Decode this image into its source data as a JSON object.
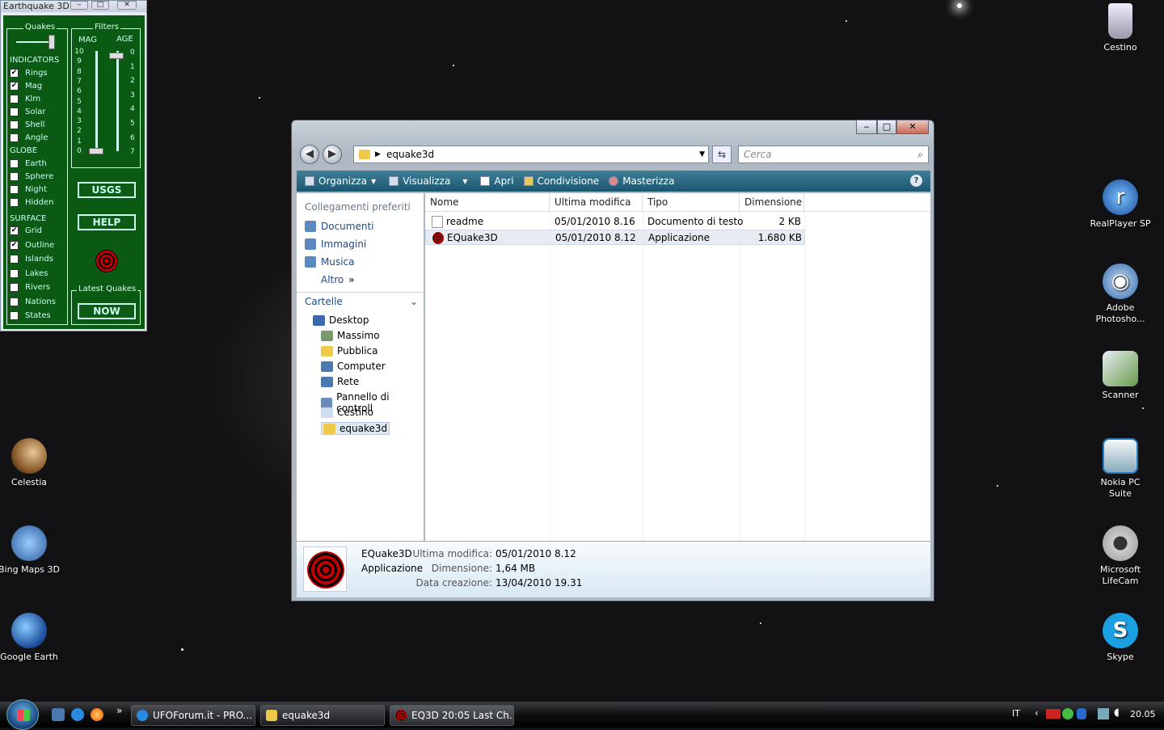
{
  "eq_window": {
    "title": "Earthquake 3D",
    "quakes_label": "Quakes",
    "filters_label": "Filters",
    "mag_label": "MAG",
    "age_label": "AGE",
    "mag_scale": [
      "10",
      "9",
      "8",
      "7",
      "6",
      "5",
      "4",
      "3",
      "2",
      "1",
      "0"
    ],
    "age_scale": [
      "0",
      "1",
      "2",
      "3",
      "4",
      "5",
      "6",
      "7"
    ],
    "indicators_label": "INDICATORS",
    "indicators": [
      {
        "label": "Rings",
        "checked": true
      },
      {
        "label": "Mag",
        "checked": true
      },
      {
        "label": "Klm",
        "checked": false
      },
      {
        "label": "Solar",
        "checked": false
      },
      {
        "label": "Shell",
        "checked": false
      },
      {
        "label": "Angle",
        "checked": false
      }
    ],
    "globe_label": "GLOBE",
    "globe": [
      {
        "label": "Earth",
        "checked": false
      },
      {
        "label": "Sphere",
        "checked": false
      },
      {
        "label": "Night",
        "checked": false
      },
      {
        "label": "Hidden",
        "checked": false
      }
    ],
    "surface_label": "SURFACE",
    "surface": [
      {
        "label": "Grid",
        "checked": true
      },
      {
        "label": "Outline",
        "checked": true
      },
      {
        "label": "Islands",
        "checked": false
      },
      {
        "label": "Lakes",
        "checked": false
      },
      {
        "label": "Rivers",
        "checked": false
      },
      {
        "label": "Nations",
        "checked": false
      },
      {
        "label": "States",
        "checked": false
      }
    ],
    "usgs_button": "USGS",
    "help_button": "HELP",
    "latest_label": "Latest Quakes",
    "now_button": "NOW",
    "checkmark": "✔"
  },
  "desktop_icons": {
    "cestino": "Cestino",
    "realplayer": "RealPlayer SP",
    "photoshop": "Adobe Photosho...",
    "scanner": "Scanner",
    "nokia": "Nokia PC Suite",
    "lifecam": "Microsoft LifeCam",
    "skype": "Skype",
    "celestia": "Celestia",
    "bingmaps": "Bing Maps 3D",
    "googleearth": "Google Earth"
  },
  "explorer": {
    "address": "equake3d",
    "search_placeholder": "Cerca",
    "commands": [
      "Organizza",
      "Visualizza",
      "Apri",
      "Condivisione",
      "Masterizza"
    ],
    "favorites_heading": "Collegamenti preferiti",
    "favorites": [
      "Documenti",
      "Immagini",
      "Musica"
    ],
    "more": "Altro",
    "folders_heading": "Cartelle",
    "tree": [
      "Desktop",
      "Massimo",
      "Pubblica",
      "Computer",
      "Rete",
      "Pannello di controll",
      "Cestino",
      "equake3d"
    ],
    "columns": [
      "Nome",
      "Ultima modifica",
      "Tipo",
      "Dimensione"
    ],
    "files": [
      {
        "name": "readme",
        "modified": "05/01/2010 8.16",
        "type": "Documento di testo",
        "size": "2 KB"
      },
      {
        "name": "EQuake3D",
        "modified": "05/01/2010 8.12",
        "type": "Applicazione",
        "size": "1.680 KB"
      }
    ],
    "details": {
      "name": "EQuake3D",
      "kind": "Applicazione",
      "modified_label": "Ultima modifica:",
      "modified": "05/01/2010 8.12",
      "size_label": "Dimensione:",
      "size": "1,64 MB",
      "created_label": "Data creazione:",
      "created": "13/04/2010 19.31"
    }
  },
  "taskbar": {
    "buttons": [
      "UFOForum.it - PRO...",
      "equake3d",
      "EQ3D  20:05 Last Ch..."
    ],
    "language": "IT",
    "clock": "20.05",
    "overflow": "»"
  },
  "colors": {
    "eq_green": "#0a5a14",
    "cmdbar": "#1b5670",
    "target_red": "#c00000"
  }
}
